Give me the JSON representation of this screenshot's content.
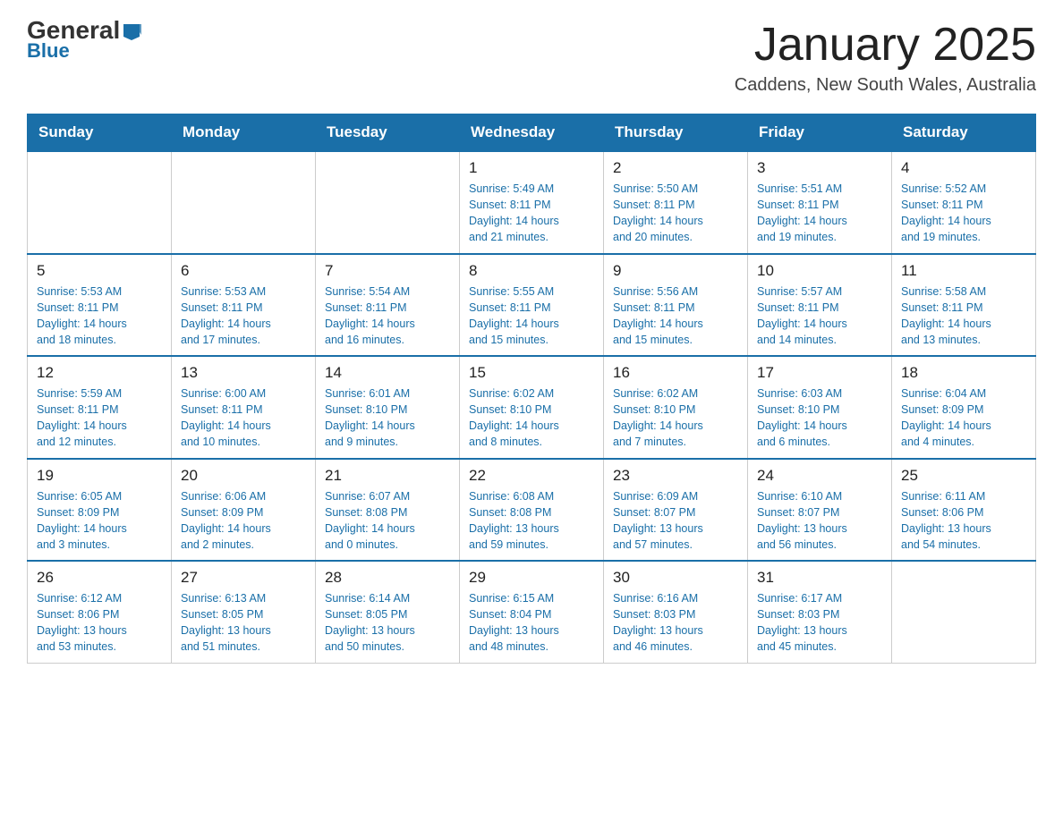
{
  "header": {
    "logo_general": "General",
    "logo_blue": "Blue",
    "title": "January 2025",
    "subtitle": "Caddens, New South Wales, Australia"
  },
  "days_of_week": [
    "Sunday",
    "Monday",
    "Tuesday",
    "Wednesday",
    "Thursday",
    "Friday",
    "Saturday"
  ],
  "weeks": [
    [
      {
        "day": "",
        "info": ""
      },
      {
        "day": "",
        "info": ""
      },
      {
        "day": "",
        "info": ""
      },
      {
        "day": "1",
        "info": "Sunrise: 5:49 AM\nSunset: 8:11 PM\nDaylight: 14 hours\nand 21 minutes."
      },
      {
        "day": "2",
        "info": "Sunrise: 5:50 AM\nSunset: 8:11 PM\nDaylight: 14 hours\nand 20 minutes."
      },
      {
        "day": "3",
        "info": "Sunrise: 5:51 AM\nSunset: 8:11 PM\nDaylight: 14 hours\nand 19 minutes."
      },
      {
        "day": "4",
        "info": "Sunrise: 5:52 AM\nSunset: 8:11 PM\nDaylight: 14 hours\nand 19 minutes."
      }
    ],
    [
      {
        "day": "5",
        "info": "Sunrise: 5:53 AM\nSunset: 8:11 PM\nDaylight: 14 hours\nand 18 minutes."
      },
      {
        "day": "6",
        "info": "Sunrise: 5:53 AM\nSunset: 8:11 PM\nDaylight: 14 hours\nand 17 minutes."
      },
      {
        "day": "7",
        "info": "Sunrise: 5:54 AM\nSunset: 8:11 PM\nDaylight: 14 hours\nand 16 minutes."
      },
      {
        "day": "8",
        "info": "Sunrise: 5:55 AM\nSunset: 8:11 PM\nDaylight: 14 hours\nand 15 minutes."
      },
      {
        "day": "9",
        "info": "Sunrise: 5:56 AM\nSunset: 8:11 PM\nDaylight: 14 hours\nand 15 minutes."
      },
      {
        "day": "10",
        "info": "Sunrise: 5:57 AM\nSunset: 8:11 PM\nDaylight: 14 hours\nand 14 minutes."
      },
      {
        "day": "11",
        "info": "Sunrise: 5:58 AM\nSunset: 8:11 PM\nDaylight: 14 hours\nand 13 minutes."
      }
    ],
    [
      {
        "day": "12",
        "info": "Sunrise: 5:59 AM\nSunset: 8:11 PM\nDaylight: 14 hours\nand 12 minutes."
      },
      {
        "day": "13",
        "info": "Sunrise: 6:00 AM\nSunset: 8:11 PM\nDaylight: 14 hours\nand 10 minutes."
      },
      {
        "day": "14",
        "info": "Sunrise: 6:01 AM\nSunset: 8:10 PM\nDaylight: 14 hours\nand 9 minutes."
      },
      {
        "day": "15",
        "info": "Sunrise: 6:02 AM\nSunset: 8:10 PM\nDaylight: 14 hours\nand 8 minutes."
      },
      {
        "day": "16",
        "info": "Sunrise: 6:02 AM\nSunset: 8:10 PM\nDaylight: 14 hours\nand 7 minutes."
      },
      {
        "day": "17",
        "info": "Sunrise: 6:03 AM\nSunset: 8:10 PM\nDaylight: 14 hours\nand 6 minutes."
      },
      {
        "day": "18",
        "info": "Sunrise: 6:04 AM\nSunset: 8:09 PM\nDaylight: 14 hours\nand 4 minutes."
      }
    ],
    [
      {
        "day": "19",
        "info": "Sunrise: 6:05 AM\nSunset: 8:09 PM\nDaylight: 14 hours\nand 3 minutes."
      },
      {
        "day": "20",
        "info": "Sunrise: 6:06 AM\nSunset: 8:09 PM\nDaylight: 14 hours\nand 2 minutes."
      },
      {
        "day": "21",
        "info": "Sunrise: 6:07 AM\nSunset: 8:08 PM\nDaylight: 14 hours\nand 0 minutes."
      },
      {
        "day": "22",
        "info": "Sunrise: 6:08 AM\nSunset: 8:08 PM\nDaylight: 13 hours\nand 59 minutes."
      },
      {
        "day": "23",
        "info": "Sunrise: 6:09 AM\nSunset: 8:07 PM\nDaylight: 13 hours\nand 57 minutes."
      },
      {
        "day": "24",
        "info": "Sunrise: 6:10 AM\nSunset: 8:07 PM\nDaylight: 13 hours\nand 56 minutes."
      },
      {
        "day": "25",
        "info": "Sunrise: 6:11 AM\nSunset: 8:06 PM\nDaylight: 13 hours\nand 54 minutes."
      }
    ],
    [
      {
        "day": "26",
        "info": "Sunrise: 6:12 AM\nSunset: 8:06 PM\nDaylight: 13 hours\nand 53 minutes."
      },
      {
        "day": "27",
        "info": "Sunrise: 6:13 AM\nSunset: 8:05 PM\nDaylight: 13 hours\nand 51 minutes."
      },
      {
        "day": "28",
        "info": "Sunrise: 6:14 AM\nSunset: 8:05 PM\nDaylight: 13 hours\nand 50 minutes."
      },
      {
        "day": "29",
        "info": "Sunrise: 6:15 AM\nSunset: 8:04 PM\nDaylight: 13 hours\nand 48 minutes."
      },
      {
        "day": "30",
        "info": "Sunrise: 6:16 AM\nSunset: 8:03 PM\nDaylight: 13 hours\nand 46 minutes."
      },
      {
        "day": "31",
        "info": "Sunrise: 6:17 AM\nSunset: 8:03 PM\nDaylight: 13 hours\nand 45 minutes."
      },
      {
        "day": "",
        "info": ""
      }
    ]
  ]
}
